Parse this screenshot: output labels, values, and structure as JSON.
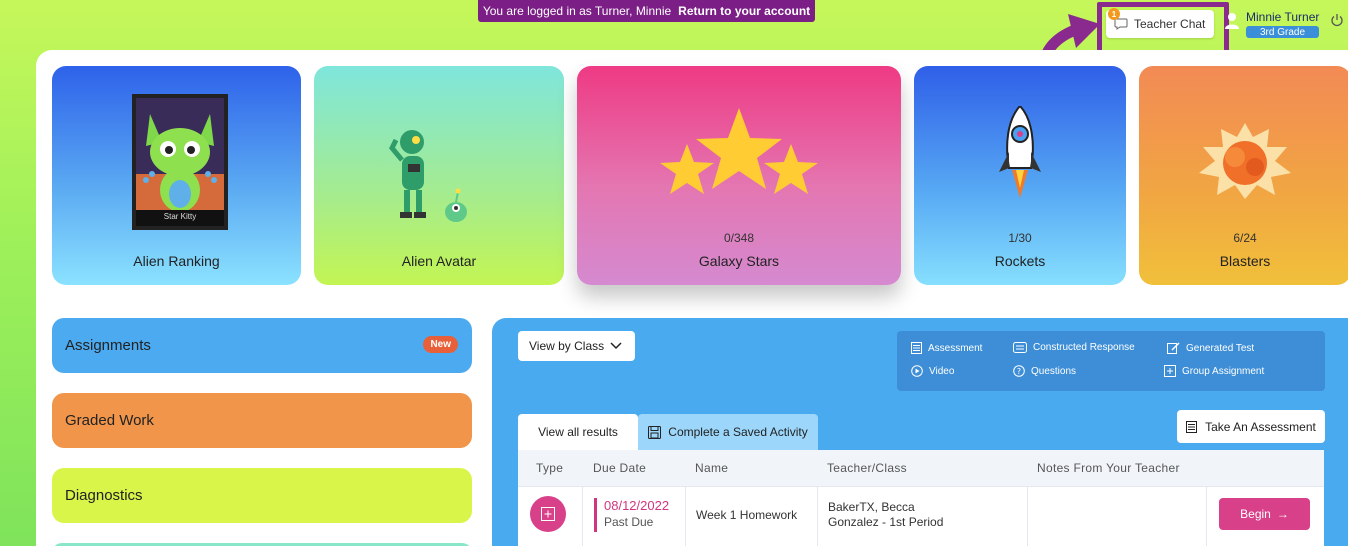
{
  "banner": {
    "text": "You are logged in as Turner, Minnie",
    "return_link": "Return to your account"
  },
  "header": {
    "chat_label": "Teacher Chat",
    "chat_badge": "1",
    "user_name": "Minnie Turner",
    "grade": "3rd Grade"
  },
  "rewards": [
    {
      "label": "Alien Ranking",
      "card_title": "Star Kitty"
    },
    {
      "label": "Alien Avatar"
    },
    {
      "label": "Galaxy Stars",
      "count": "0/348"
    },
    {
      "label": "Rockets",
      "count": "1/30"
    },
    {
      "label": "Blasters",
      "count": "6/24"
    }
  ],
  "categories": {
    "assignments": "Assignments",
    "new_badge": "New",
    "graded": "Graded Work",
    "diagnostics": "Diagnostics"
  },
  "work": {
    "view_by": "View by Class",
    "legend": {
      "assessment": "Assessment",
      "constructed": "Constructed Response",
      "generated": "Generated Test",
      "video": "Video",
      "questions": "Questions",
      "group": "Group Assignment"
    },
    "tab_all": "View all results",
    "tab_saved": "Complete a Saved Activity",
    "take_assessment": "Take An Assessment",
    "columns": [
      "Type",
      "Due Date",
      "Name",
      "Teacher/Class",
      "Notes From Your Teacher"
    ],
    "rows": [
      {
        "due_date": "08/12/2022",
        "status": "Past Due",
        "name": "Week 1 Homework",
        "teacher": "BakerTX, Becca",
        "class": "Gonzalez - 1st Period",
        "action": "Begin"
      }
    ]
  },
  "colors": {
    "accent_pink": "#d9408a",
    "highlight_purple": "#8a2a8e",
    "banner_purple": "#7b1f86"
  }
}
